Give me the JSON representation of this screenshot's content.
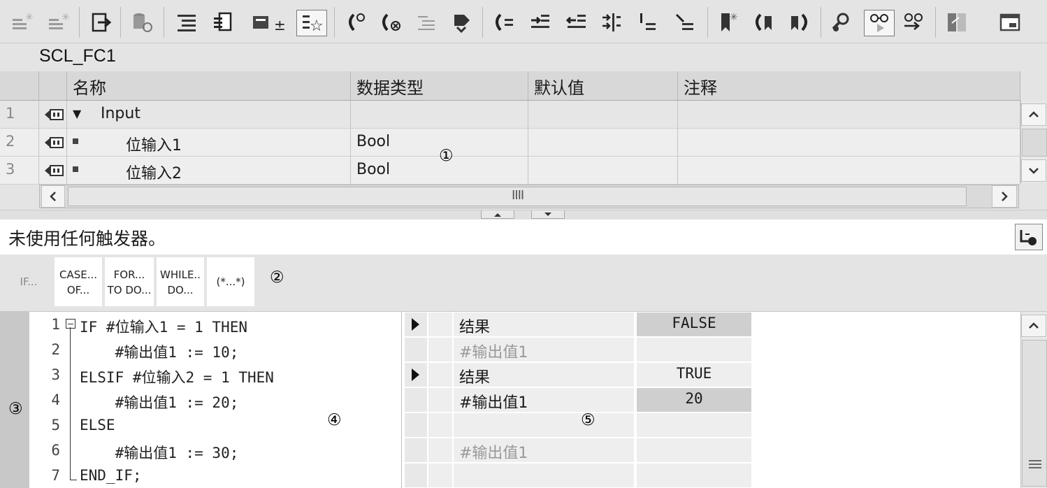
{
  "block": {
    "title": "SCL_FC1"
  },
  "interface": {
    "columns": [
      "名称",
      "数据类型",
      "默认值",
      "注释"
    ],
    "rows": [
      {
        "no": "1",
        "name": "Input",
        "type": "",
        "default": "",
        "comment": ""
      },
      {
        "no": "2",
        "name": "位输入1",
        "type": "Bool",
        "default": "",
        "comment": ""
      },
      {
        "no": "3",
        "name": "位输入2",
        "type": "Bool",
        "default": "",
        "comment": ""
      }
    ],
    "hscroll_grip": "IIII"
  },
  "trigger": {
    "text": "未使用任何触发器。"
  },
  "palette": {
    "items": [
      {
        "l1": "IF...",
        "l2": ""
      },
      {
        "l1": "CASE...",
        "l2": "OF..."
      },
      {
        "l1": "FOR...",
        "l2": "TO DO..."
      },
      {
        "l1": "WHILE..",
        "l2": "DO..."
      },
      {
        "l1": "(*...*)",
        "l2": ""
      }
    ]
  },
  "editor": {
    "line_numbers": [
      "1",
      "2",
      "3",
      "4",
      "5",
      "6",
      "7"
    ],
    "lines": [
      "IF #位输入1 = 1 THEN",
      "    #输出值1 := 10;",
      "ELSIF #位输入2 = 1 THEN",
      "    #输出值1 := 20;",
      "ELSE",
      "    #输出值1 := 30;",
      "END_IF;"
    ]
  },
  "monitor": {
    "rows": [
      {
        "name": "结果",
        "value": "FALSE"
      },
      {
        "name": "#输出值1",
        "value": ""
      },
      {
        "name": "结果",
        "value": "TRUE"
      },
      {
        "name": "#输出值1",
        "value": "20"
      },
      {
        "name": "",
        "value": ""
      },
      {
        "name": "#输出值1",
        "value": ""
      },
      {
        "name": "",
        "value": ""
      }
    ]
  },
  "markers": {
    "m1": "①",
    "m2": "②",
    "m3": "③",
    "m4": "④",
    "m5": "⑤"
  },
  "icons": [
    "insert-row-icon",
    "add-row-icon",
    "export-icon",
    "db-icon",
    "list-icon",
    "structure-icon",
    "network-download-icon",
    "favorites-icon",
    "goto-breakpoint-icon",
    "delete-breakpoint-icon",
    "comment-icon",
    "step-icon",
    "jump-icon",
    "indent-icon",
    "outdent-icon",
    "align-icon",
    "bracket-icon",
    "marker-icon",
    "bookmark-icon",
    "prev-icon",
    "next-icon",
    "watch-icon",
    "monitor-icon",
    "monitor-all-icon",
    "compare-icon",
    "window-icon"
  ]
}
